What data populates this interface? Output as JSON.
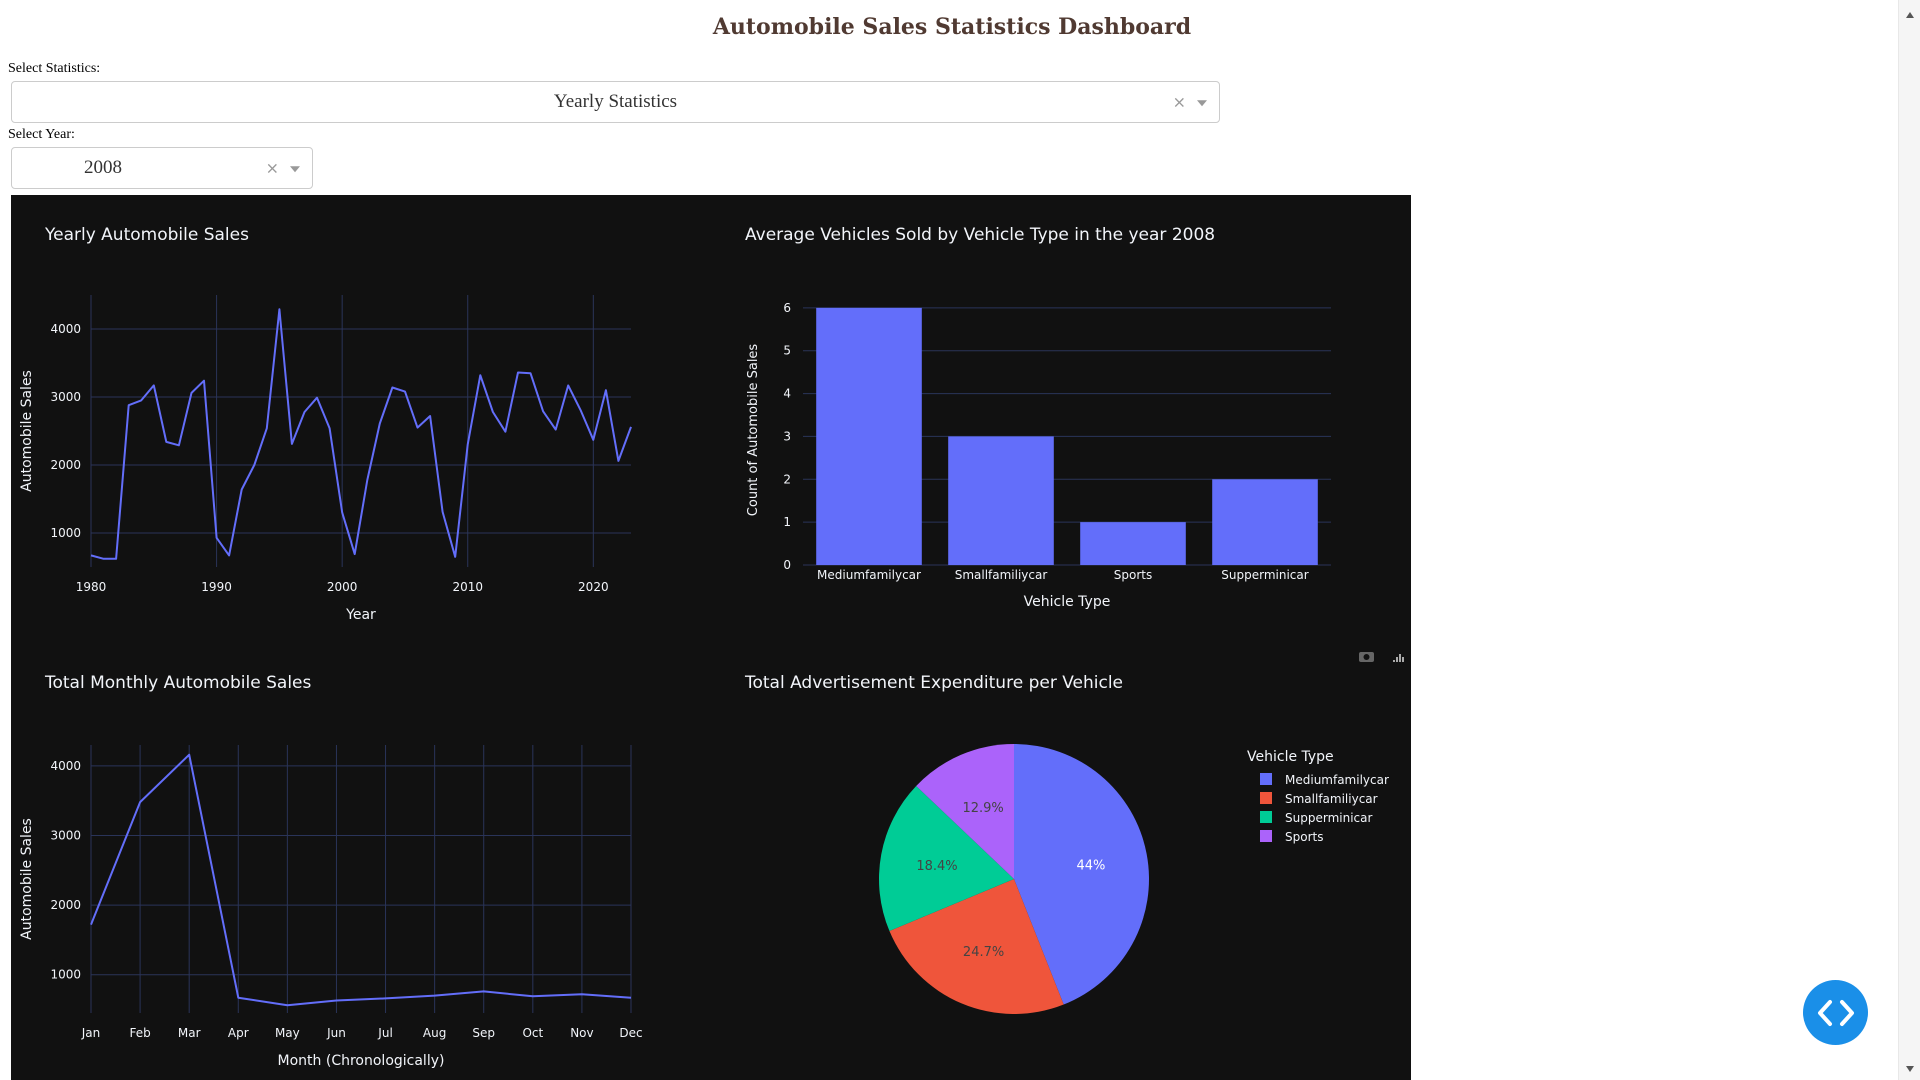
{
  "page": {
    "title": "Automobile Sales Statistics Dashboard",
    "stats_label": "Select Statistics:",
    "stats_value": "Yearly Statistics",
    "year_label": "Select Year:",
    "year_value": "2008",
    "clear_symbol": "×"
  },
  "colors": {
    "accent": "#636efa",
    "panel_bg": "#111111",
    "fab": "#1a8fe8",
    "title": "#503a32"
  },
  "modebar": [
    "camera-icon",
    "plotly-logo-icon"
  ],
  "chart_data": [
    {
      "type": "line",
      "title": "Yearly Automobile Sales",
      "xlabel": "Year",
      "ylabel": "Automobile Sales",
      "xlim": [
        1980,
        2023
      ],
      "ylim": [
        500,
        4500
      ],
      "xticks": [
        1980,
        1990,
        2000,
        2010,
        2020
      ],
      "yticks": [
        1000,
        2000,
        3000,
        4000
      ],
      "x": [
        1980,
        1981,
        1982,
        1983,
        1984,
        1985,
        1986,
        1987,
        1988,
        1989,
        1990,
        1991,
        1992,
        1993,
        1994,
        1995,
        1996,
        1997,
        1998,
        1999,
        2000,
        2001,
        2002,
        2003,
        2004,
        2005,
        2006,
        2007,
        2008,
        2009,
        2010,
        2011,
        2012,
        2013,
        2014,
        2015,
        2016,
        2017,
        2018,
        2019,
        2020,
        2021,
        2022,
        2023
      ],
      "y": [
        670,
        620,
        620,
        2880,
        2950,
        3170,
        2340,
        2290,
        3060,
        3240,
        930,
        670,
        1640,
        2000,
        2540,
        4290,
        2310,
        2780,
        2990,
        2540,
        1300,
        690,
        1780,
        2610,
        3140,
        3080,
        2550,
        2720,
        1310,
        650,
        2300,
        3320,
        2780,
        2490,
        3360,
        3350,
        2790,
        2520,
        3170,
        2800,
        2370,
        3100,
        2060,
        2560
      ],
      "grid": true
    },
    {
      "type": "bar",
      "title": "Average Vehicles Sold by Vehicle Type in the year 2008",
      "xlabel": "Vehicle Type",
      "ylabel": "Count of Automobile Sales",
      "categories": [
        "Mediumfamilycar",
        "Smallfamiliycar",
        "Sports",
        "Supperminicar"
      ],
      "values": [
        6,
        3,
        1,
        2
      ],
      "ylim": [
        0,
        6.3
      ],
      "yticks": [
        0,
        1,
        2,
        3,
        4,
        5,
        6
      ],
      "grid": true
    },
    {
      "type": "line",
      "title": "Total Monthly Automobile Sales",
      "xlabel": "Month (Chronologically)",
      "ylabel": "Automobile Sales",
      "categories": [
        "Jan",
        "Feb",
        "Mar",
        "Apr",
        "May",
        "Jun",
        "Jul",
        "Aug",
        "Sep",
        "Oct",
        "Nov",
        "Dec"
      ],
      "values": [
        1720,
        3480,
        4160,
        670,
        560,
        630,
        660,
        700,
        760,
        690,
        720,
        670
      ],
      "ylim": [
        450,
        4300
      ],
      "yticks": [
        1000,
        2000,
        3000,
        4000
      ],
      "grid": true
    },
    {
      "type": "pie",
      "title": "Total Advertisement Expenditure per Vehicle",
      "legend_title": "Vehicle Type",
      "legend_position": "right",
      "labels": [
        "Mediumfamilycar",
        "Smallfamiliycar",
        "Supperminicar",
        "Sports"
      ],
      "values": [
        44,
        24.7,
        18.4,
        12.9
      ],
      "value_labels": [
        "44%",
        "24.7%",
        "18.4%",
        "12.9%"
      ],
      "colors": [
        "#636efa",
        "#ef553b",
        "#00cc96",
        "#ab63fa"
      ]
    }
  ]
}
